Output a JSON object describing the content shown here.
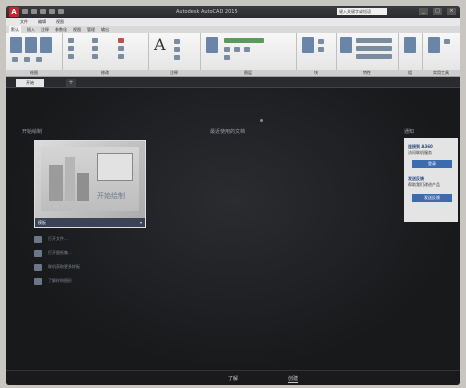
{
  "window": {
    "title": "Autodesk AutoCAD 2015"
  },
  "titlebar": {
    "logo": "A",
    "search_placeholder": "键入关键字或短语",
    "controls": [
      "_",
      "□",
      "×"
    ]
  },
  "menubar": {
    "items": [
      "文件",
      "编辑",
      "视图"
    ]
  },
  "ribbon": {
    "tabs": [
      "默认",
      "插入",
      "注释",
      "参数化",
      "视图",
      "管理",
      "输出"
    ],
    "panels": [
      "绘图",
      "修改",
      "注释",
      "图层",
      "块",
      "特性",
      "组",
      "实用工具"
    ]
  },
  "doc_tabs": {
    "tab_label": "开始",
    "add_label": "+"
  },
  "start": {
    "start_label": "开始绘制",
    "recent_label": "最近使用的文档",
    "notify_label": "通知",
    "template": {
      "caption": "开始绘制",
      "footer": "模板"
    },
    "links": [
      "打开文件...",
      "打开图纸集...",
      "联机获取更多样板",
      "了解样例图形"
    ]
  },
  "notifications": [
    {
      "title": "连接到 A360",
      "text": "访问联机服务",
      "button": "登录"
    },
    {
      "title": "发送反馈",
      "text": "帮助我们改进产品",
      "button": "发送反馈"
    }
  ],
  "bottom": {
    "tabs": [
      "了解",
      "创建"
    ],
    "active": "创建"
  }
}
